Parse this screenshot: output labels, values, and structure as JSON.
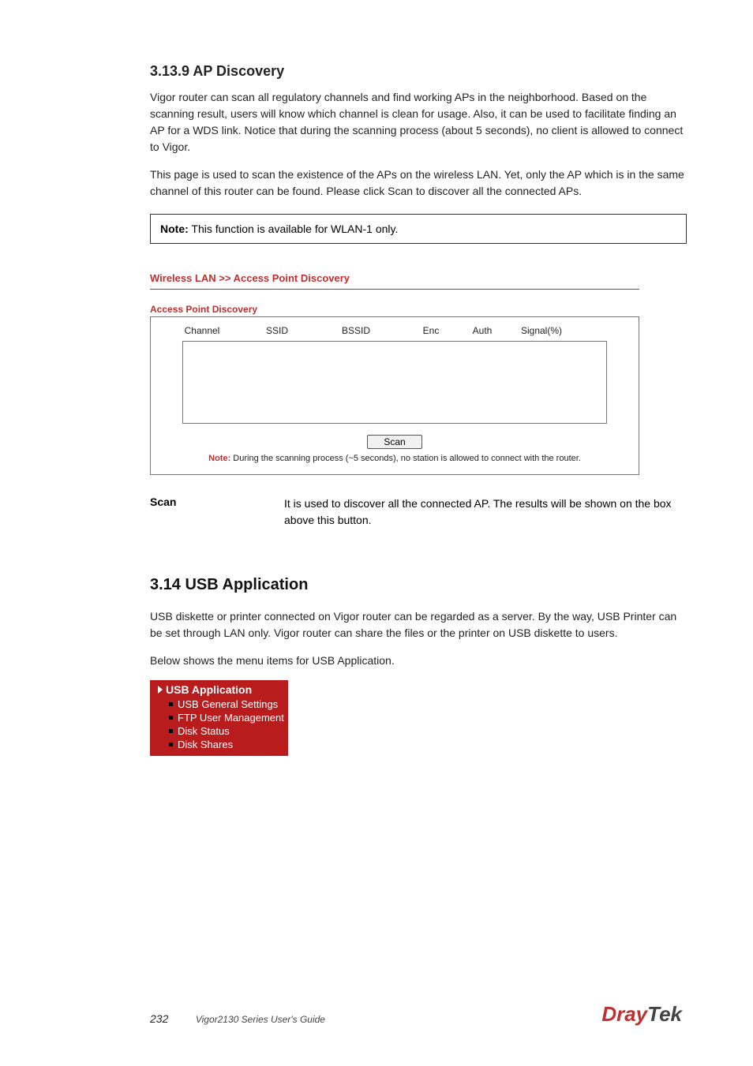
{
  "section": {
    "heading": "3.13.9 AP Discovery",
    "p1": "Vigor router can scan all regulatory channels and find working APs in the neighborhood. Based on the scanning result, users will know which channel is clean for usage. Also, it can be used to facilitate finding an AP for a WDS link. Notice that during the scanning process (about 5 seconds), no client is allowed to connect to Vigor.",
    "p2": "This page is used to scan the existence of the APs on the wireless LAN. Yet, only the AP which is in the same channel of this router can be found. Please click Scan to discover all the connected APs.",
    "note": {
      "label": "Note:",
      "text": " This function is available for WLAN-1 only."
    }
  },
  "screenshot": {
    "breadcrumb": "Wireless LAN >> Access Point Discovery",
    "subheading": "Access Point Discovery",
    "columns": {
      "channel": "Channel",
      "ssid": "SSID",
      "bssid": "BSSID",
      "enc": "Enc",
      "auth": "Auth",
      "signal": "Signal(%)"
    },
    "scan_button": "Scan",
    "note_label": "Note:",
    "note_text": " During the scanning process (~5 seconds), no station is allowed to connect with the router."
  },
  "definition": {
    "term": "Scan",
    "desc": "It is used to discover all the connected AP. The results will be shown on the box above this button."
  },
  "usb_section": {
    "heading": "3.14 USB Application",
    "p1": "USB diskette or printer connected on Vigor router can be regarded as a server. By the way, USB Printer can be set through LAN only. Vigor router can share the files or the printer on USB diskette to users.",
    "p2": "Below shows the menu items for USB Application.",
    "nav": {
      "head": "USB Application",
      "items": [
        "USB General Settings",
        "FTP User Management",
        "Disk Status",
        "Disk Shares"
      ]
    }
  },
  "footer": {
    "page": "232",
    "manual": "Vigor2130 Series User's Guide",
    "brand1": "Dray",
    "brand2": "Tek"
  }
}
